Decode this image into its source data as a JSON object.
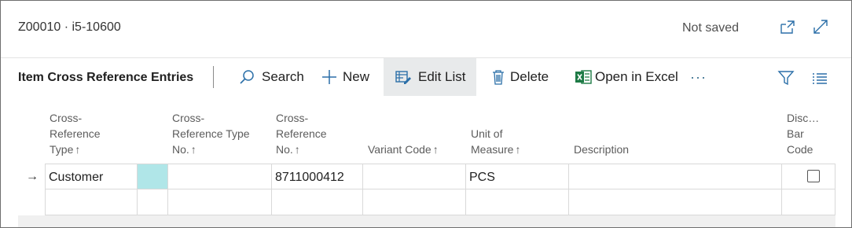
{
  "header": {
    "title": "Z00010 · i5-10600",
    "status": "Not saved"
  },
  "action_bar": {
    "title": "Item Cross Reference Entries",
    "search_label": "Search",
    "new_label": "New",
    "edit_list_label": "Edit List",
    "delete_label": "Delete",
    "open_excel_label": "Open in Excel",
    "more_label": "···"
  },
  "columns": {
    "cross_ref_type": {
      "l1": "Cross-",
      "l2": "Reference",
      "l3": "Type",
      "sort": "↑"
    },
    "cross_ref_type_no": {
      "l1": "Cross-",
      "l2": "Reference Type",
      "l3": "No.",
      "sort": "↑"
    },
    "cross_ref_no": {
      "l1": "Cross-",
      "l2": "Reference",
      "l3": "No.",
      "sort": "↑"
    },
    "variant_code": {
      "l1": "Variant Code",
      "sort": "↑"
    },
    "unit_of_measure": {
      "l1": "Unit of",
      "l2": "Measure",
      "sort": "↑"
    },
    "description": {
      "l1": "Description"
    },
    "discontinue_bar_code": {
      "l1": "Disc…",
      "l2": "Bar",
      "l3": "Code"
    }
  },
  "rows": [
    {
      "indicator": "→",
      "cross_ref_type": "Customer",
      "cross_ref_type_no": "",
      "cross_ref_no": "8711000412",
      "variant_code": "",
      "unit_of_measure": "PCS",
      "description": "",
      "discontinue_bar_code": false
    },
    {
      "indicator": "",
      "cross_ref_type": "",
      "cross_ref_type_no": "",
      "cross_ref_no": "",
      "variant_code": "",
      "unit_of_measure": "",
      "description": "",
      "discontinue_bar_code": false
    }
  ],
  "colors": {
    "accent": "#2b6fa8",
    "excel_green": "#1d7a45",
    "selection_teal": "#b0e6e8",
    "active_button_bg": "#e8eaeb"
  },
  "icons": {
    "header": [
      "popout-icon",
      "expand-icon"
    ],
    "action_bar": [
      "search-icon",
      "plus-icon",
      "edit-list-icon",
      "trash-icon",
      "excel-icon",
      "filter-icon",
      "list-view-icon"
    ]
  }
}
